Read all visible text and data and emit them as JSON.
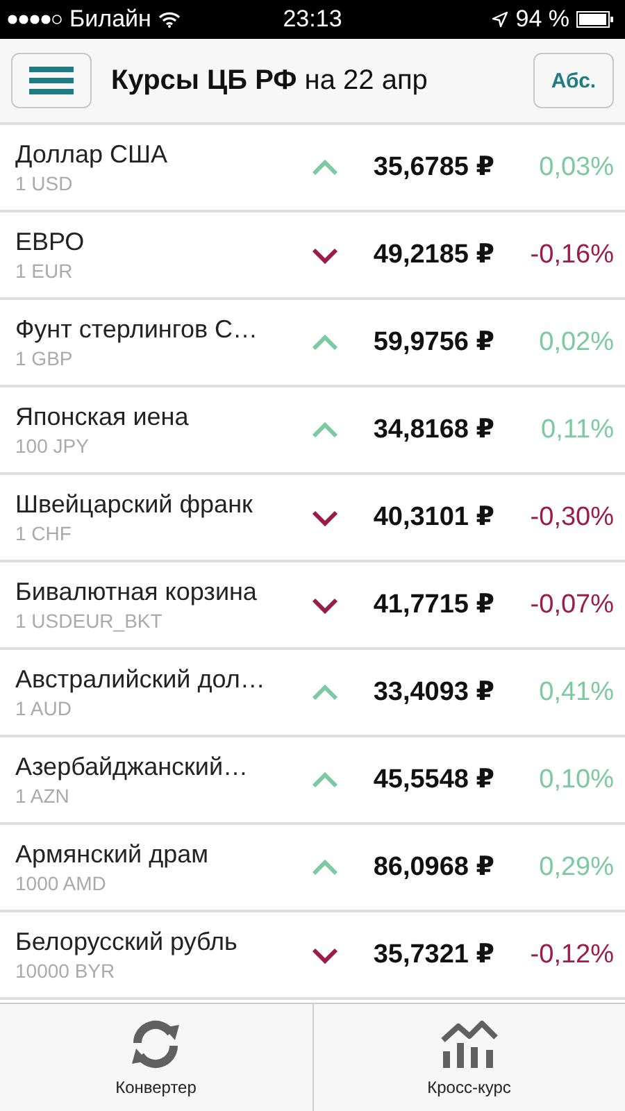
{
  "status_bar": {
    "carrier": "Билайн",
    "time": "23:13",
    "battery": "94 %"
  },
  "header": {
    "title": "**Курсы ЦБ РФ** на 22 апр",
    "mode_button": "Абс."
  },
  "rates": [
    {
      "name": "Доллар США",
      "unit": "1 USD",
      "kind": "up",
      "rate": "35,6785 ₽",
      "change": "0,03%"
    },
    {
      "name": "ЕВРО",
      "unit": "1 EUR",
      "kind": "down",
      "rate": "49,2185 ₽",
      "change": "-0,16%"
    },
    {
      "name": "Фунт стерлингов С…",
      "unit": "1 GBP",
      "kind": "up",
      "rate": "59,9756 ₽",
      "change": "0,02%"
    },
    {
      "name": "Японская иена",
      "unit": "100 JPY",
      "kind": "up",
      "rate": "34,8168 ₽",
      "change": "0,11%"
    },
    {
      "name": "Швейцарский франк",
      "unit": "1 CHF",
      "kind": "down",
      "rate": "40,3101 ₽",
      "change": "-0,30%"
    },
    {
      "name": "Бивалютная корзина",
      "unit": "1 USDEUR_BKT",
      "kind": "down",
      "rate": "41,7715 ₽",
      "change": "-0,07%"
    },
    {
      "name": "Австралийский дол…",
      "unit": "1 AUD",
      "kind": "up",
      "rate": "33,4093 ₽",
      "change": "0,41%"
    },
    {
      "name": "Азербайджанский…",
      "unit": "1 AZN",
      "kind": "up",
      "rate": "45,5548 ₽",
      "change": "0,10%"
    },
    {
      "name": "Армянский драм",
      "unit": "1000 AMD",
      "kind": "up",
      "rate": "86,0968 ₽",
      "change": "0,29%"
    },
    {
      "name": "Белорусский рубль",
      "unit": "10000 BYR",
      "kind": "down",
      "rate": "35,7321 ₽",
      "change": "-0,12%"
    }
  ],
  "tab_bar": [
    {
      "kind": "converter",
      "label": "Конвертер"
    },
    {
      "kind": "cross",
      "label": "Кросс-курс"
    }
  ]
}
